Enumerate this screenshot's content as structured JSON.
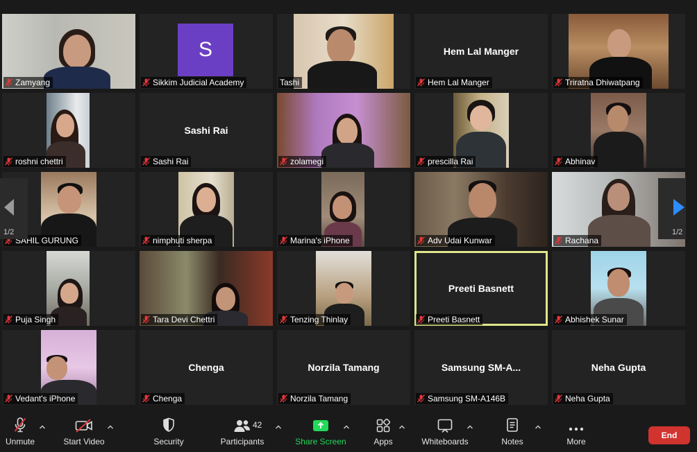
{
  "participants": [
    {
      "name": "Zamyang",
      "display": "Zamyang",
      "type": "video"
    },
    {
      "name": "Sikkim Judicial Academy",
      "display": "Sikkim Judicial Academy",
      "type": "avatar",
      "avatar_letter": "S"
    },
    {
      "name": "Tashi",
      "display": "Tashi",
      "type": "video"
    },
    {
      "name": "Hem Lal Manger",
      "display": "Hem Lal Manger",
      "type": "name",
      "center_text": "Hem Lal Manger"
    },
    {
      "name": "Triratna Dhiwatpang",
      "display": "Triratna Dhiwatpang",
      "type": "video"
    },
    {
      "name": "roshni chettri",
      "display": "roshni chettri",
      "type": "video"
    },
    {
      "name": "Sashi Rai",
      "display": "Sashi Rai",
      "type": "name",
      "center_text": "Sashi Rai"
    },
    {
      "name": "zolamegi",
      "display": "zolamegi",
      "type": "video"
    },
    {
      "name": "prescilla Rai",
      "display": "prescilla Rai",
      "type": "video"
    },
    {
      "name": "Abhinav",
      "display": "Abhinav",
      "type": "video"
    },
    {
      "name": "SAHIL GURUNG",
      "display": "SAHIL GURUNG",
      "type": "video"
    },
    {
      "name": "nimphuti sherpa",
      "display": "nimphuti sherpa",
      "type": "video"
    },
    {
      "name": "Marina's iPhone",
      "display": "Marina's iPhone",
      "type": "video"
    },
    {
      "name": "Adv Udai Kunwar",
      "display": "Adv Udai Kunwar",
      "type": "video"
    },
    {
      "name": "Rachana",
      "display": "Rachana",
      "type": "video"
    },
    {
      "name": "Puja Singh",
      "display": "Puja Singh",
      "type": "video"
    },
    {
      "name": "Tara Devi Chettri",
      "display": "Tara Devi Chettri",
      "type": "video"
    },
    {
      "name": "Tenzing Thinlay",
      "display": "Tenzing Thinlay",
      "type": "video"
    },
    {
      "name": "Preeti Basnett",
      "display": "Preeti Basnett",
      "type": "name",
      "center_text": "Preeti Basnett",
      "active_speaker": true
    },
    {
      "name": "Abhishek Sunar",
      "display": "Abhishek Sunar",
      "type": "video"
    },
    {
      "name": "Vedant's iPhone",
      "display": "Vedant's iPhone",
      "type": "video"
    },
    {
      "name": "Chenga",
      "display": "Chenga",
      "type": "name",
      "center_text": "Chenga"
    },
    {
      "name": "Norzila Tamang",
      "display": "Norzila Tamang",
      "type": "name",
      "center_text": "Norzila Tamang"
    },
    {
      "name": "Samsung SM-A146B",
      "display": "Samsung SM-A146B",
      "type": "name",
      "center_text": "Samsung  SM-A..."
    },
    {
      "name": "Neha Gupta",
      "display": "Neha Gupta",
      "type": "name",
      "center_text": "Neha Gupta"
    }
  ],
  "pagination": {
    "left_page": "1/2",
    "right_page": "1/2"
  },
  "toolbar": {
    "unmute": "Unmute",
    "start_video": "Start Video",
    "security": "Security",
    "participants": "Participants",
    "participants_count": "42",
    "share_screen": "Share Screen",
    "apps": "Apps",
    "whiteboards": "Whiteboards",
    "notes": "Notes",
    "more": "More",
    "end": "End"
  },
  "colors": {
    "background": "#1a1a1a",
    "tile": "#232323",
    "active_speaker_border": "#dfe68a",
    "avatar": "#6b3fc4",
    "muted_icon": "#e0373a",
    "share_screen": "#23d959",
    "end_button": "#d1332f",
    "nav_arrow": "#2d8cff"
  }
}
